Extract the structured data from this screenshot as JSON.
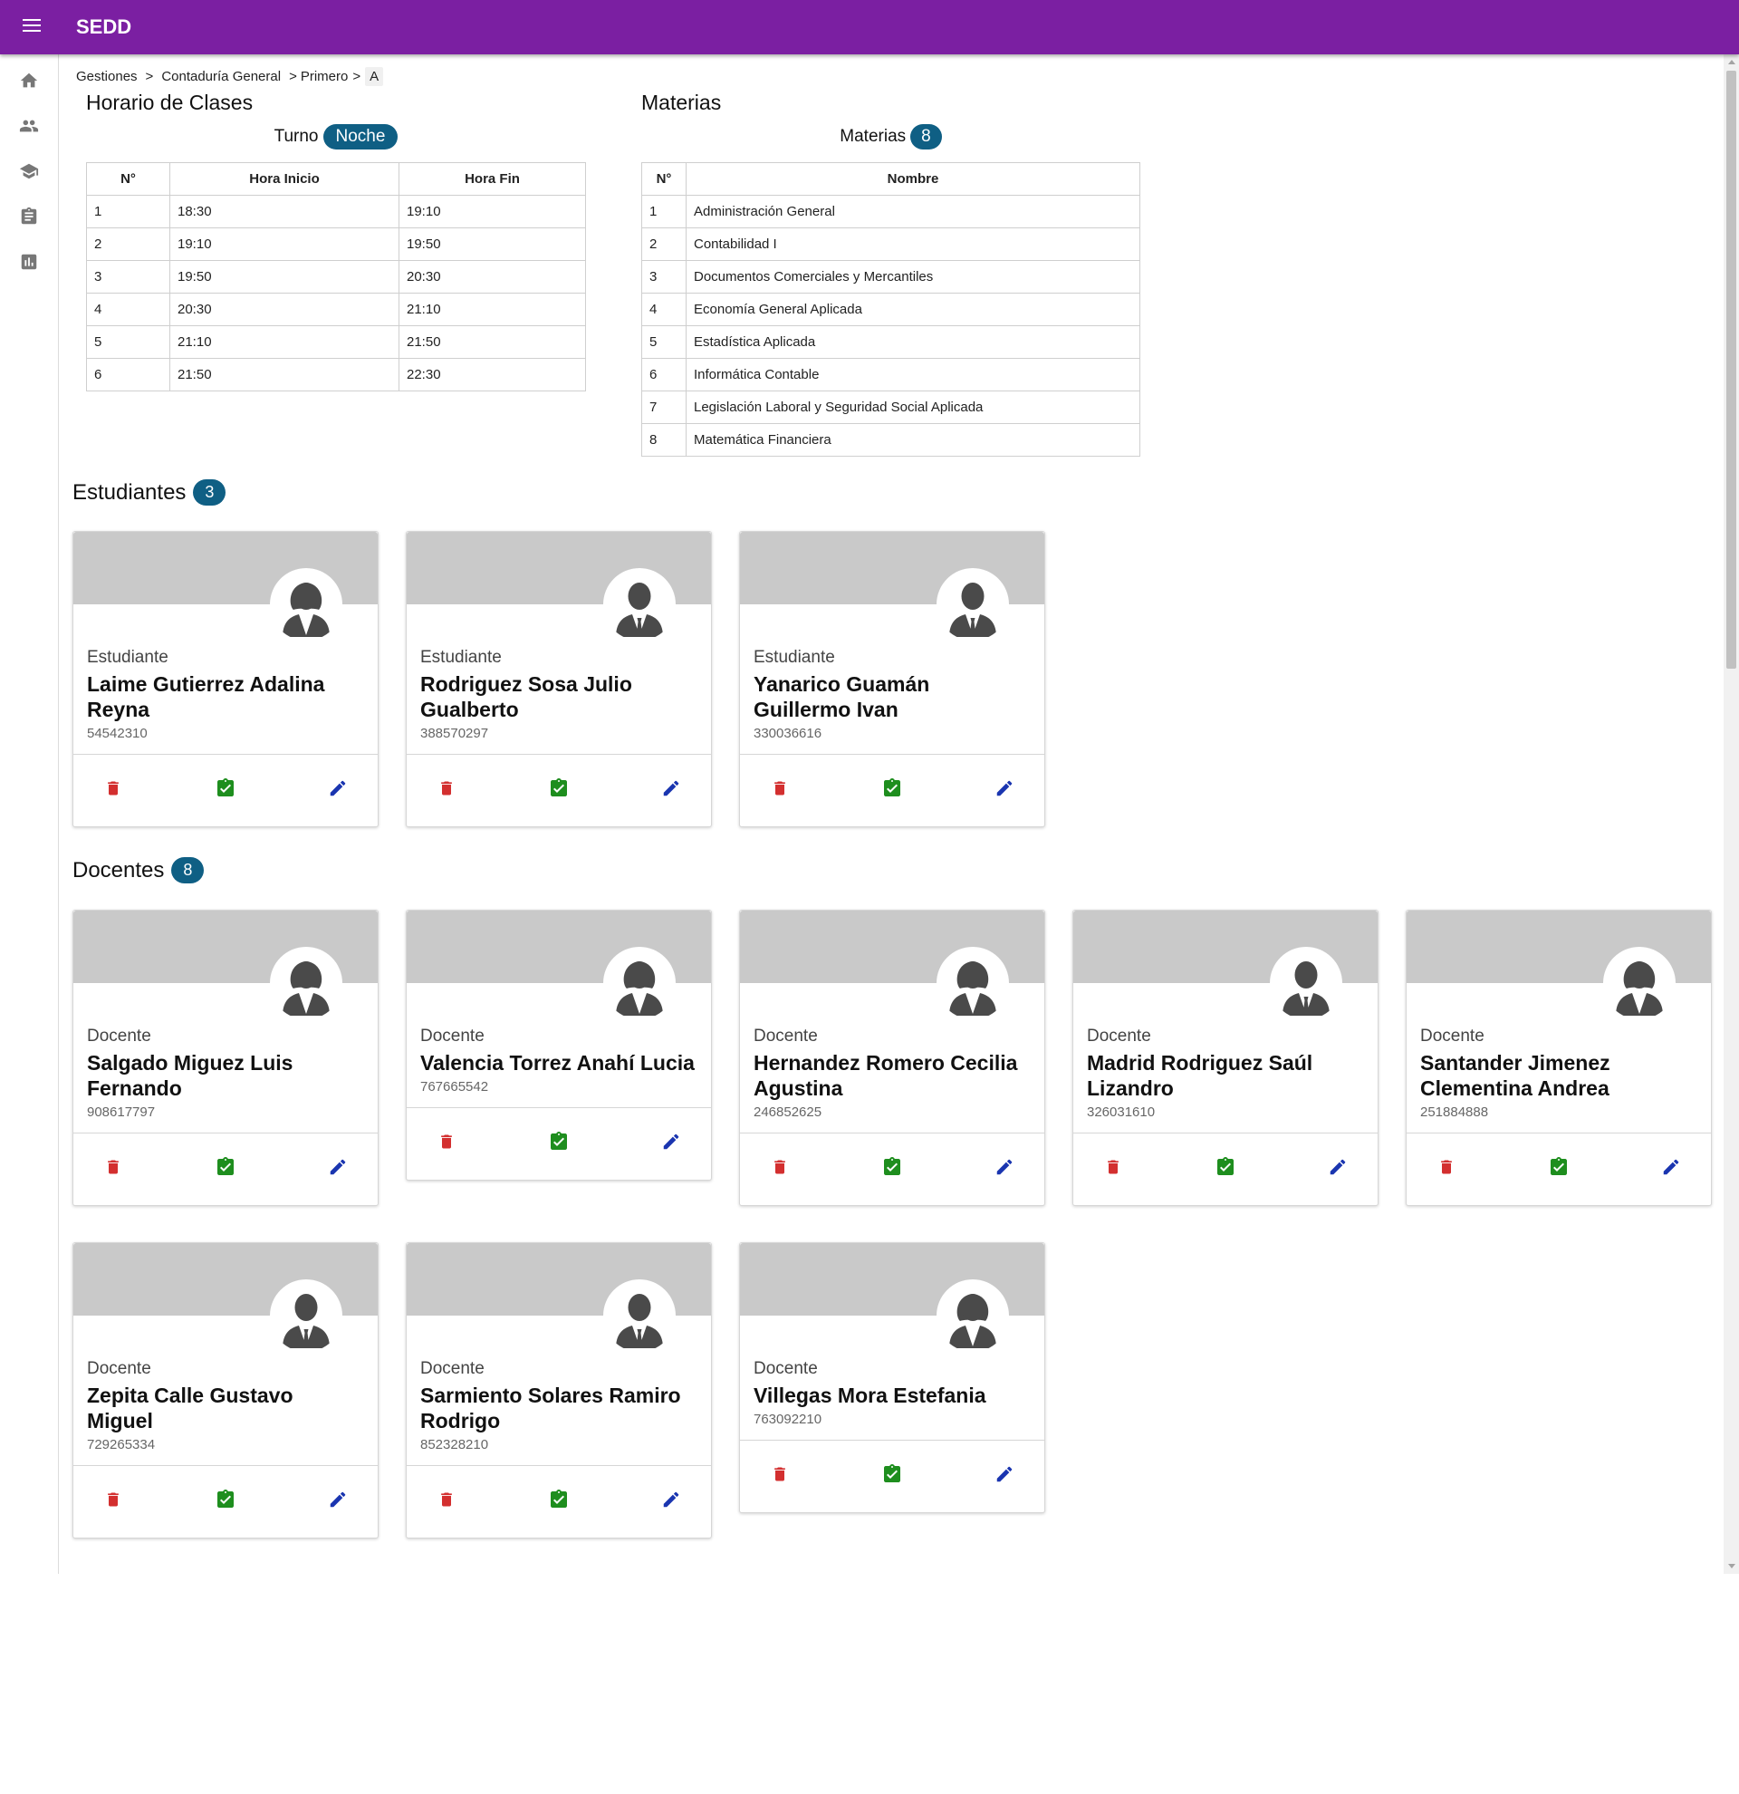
{
  "app": {
    "title": "SEDD"
  },
  "icons": {
    "menu": "menu-icon",
    "sidebar": [
      "home-icon",
      "people-icon",
      "school-icon",
      "assignment-icon",
      "bar-chart-icon"
    ],
    "card_actions": [
      "delete-icon",
      "assignment-check-icon",
      "edit-icon"
    ]
  },
  "colors": {
    "appbar": "#7b1fa2",
    "pill": "#0f5f84",
    "delete": "#d32f2f",
    "check": "#1e8e1e",
    "edit": "#1a35b0",
    "card_header": "#c9c9c9",
    "avatar_icon": "#4a4a4a"
  },
  "breadcrumb": [
    "Gestiones",
    "Contaduría General",
    "Primero",
    "A"
  ],
  "horario": {
    "title": "Horario de Clases",
    "turno_label": "Turno",
    "turno_value": "Noche",
    "headers": [
      "N°",
      "Hora Inicio",
      "Hora Fin"
    ],
    "rows": [
      [
        "1",
        "18:30",
        "19:10"
      ],
      [
        "2",
        "19:10",
        "19:50"
      ],
      [
        "3",
        "19:50",
        "20:30"
      ],
      [
        "4",
        "20:30",
        "21:10"
      ],
      [
        "5",
        "21:10",
        "21:50"
      ],
      [
        "6",
        "21:50",
        "22:30"
      ]
    ]
  },
  "materias": {
    "title": "Materias",
    "count_label": "Materias",
    "count": "8",
    "headers": [
      "N°",
      "Nombre"
    ],
    "rows": [
      [
        "1",
        "Administración General"
      ],
      [
        "2",
        "Contabilidad I"
      ],
      [
        "3",
        "Documentos Comerciales y Mercantiles"
      ],
      [
        "4",
        "Economía General Aplicada"
      ],
      [
        "5",
        "Estadística Aplicada"
      ],
      [
        "6",
        "Informática Contable"
      ],
      [
        "7",
        "Legislación Laboral y Seguridad Social Aplicada"
      ],
      [
        "8",
        "Matemática Financiera"
      ]
    ]
  },
  "estudiantes": {
    "title": "Estudiantes",
    "count": "3",
    "cards": [
      {
        "role": "Estudiante",
        "name": "Laime Gutierrez Adalina Reyna",
        "id": "54542310",
        "avatar": "female-person-icon"
      },
      {
        "role": "Estudiante",
        "name": "Rodriguez Sosa Julio Gualberto",
        "id": "388570297",
        "avatar": "male-person-icon"
      },
      {
        "role": "Estudiante",
        "name": "Yanarico Guamán Guillermo Ivan",
        "id": "330036616",
        "avatar": "male-person-icon"
      }
    ]
  },
  "docentes": {
    "title": "Docentes",
    "count": "8",
    "cards": [
      {
        "role": "Docente",
        "name": "Salgado Miguez Luis Fernando",
        "id": "908617797",
        "avatar": "female-person-icon"
      },
      {
        "role": "Docente",
        "name": "Valencia Torrez Anahí Lucia",
        "id": "767665542",
        "avatar": "female-person-icon"
      },
      {
        "role": "Docente",
        "name": "Hernandez Romero Cecilia Agustina",
        "id": "246852625",
        "avatar": "female-person-icon"
      },
      {
        "role": "Docente",
        "name": "Madrid Rodriguez Saúl Lizandro",
        "id": "326031610",
        "avatar": "male-person-icon"
      },
      {
        "role": "Docente",
        "name": "Santander Jimenez Clementina Andrea",
        "id": "251884888",
        "avatar": "female-person-icon"
      },
      {
        "role": "Docente",
        "name": "Zepita Calle Gustavo Miguel",
        "id": "729265334",
        "avatar": "male-person-icon"
      },
      {
        "role": "Docente",
        "name": "Sarmiento Solares Ramiro Rodrigo",
        "id": "852328210",
        "avatar": "male-person-icon"
      },
      {
        "role": "Docente",
        "name": "Villegas Mora Estefania",
        "id": "763092210",
        "avatar": "female-person-icon"
      }
    ]
  }
}
